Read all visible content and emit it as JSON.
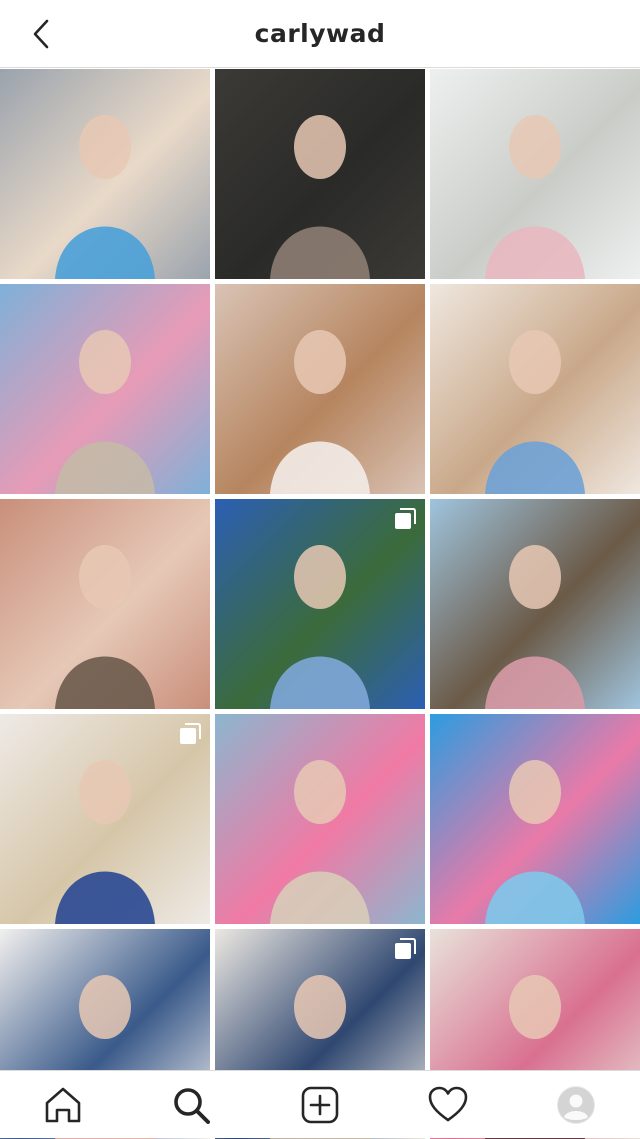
{
  "header": {
    "username": "carlywad",
    "back_icon": "chevron-left-icon"
  },
  "grid": {
    "posts": [
      {
        "id": "post-1",
        "multi": false,
        "colors": [
          "#9aa3ad",
          "#4aa0d8",
          "#e9d9c8"
        ]
      },
      {
        "id": "post-2",
        "multi": false,
        "colors": [
          "#3b3a36",
          "#8d7d72",
          "#2a2a28"
        ]
      },
      {
        "id": "post-3",
        "multi": false,
        "colors": [
          "#eef0f0",
          "#e8b8c0",
          "#c9ccc7"
        ]
      },
      {
        "id": "post-4",
        "multi": false,
        "colors": [
          "#7fb0d8",
          "#c5b9a7",
          "#e79bb6"
        ]
      },
      {
        "id": "post-5",
        "multi": false,
        "colors": [
          "#d9c3b5",
          "#f3ece8",
          "#b6855f"
        ]
      },
      {
        "id": "post-6",
        "multi": false,
        "colors": [
          "#efe7df",
          "#6fa2d6",
          "#c9a889"
        ]
      },
      {
        "id": "post-7",
        "multi": false,
        "colors": [
          "#c98f7b",
          "#6b5b4d",
          "#e6c8b7"
        ]
      },
      {
        "id": "post-8",
        "multi": true,
        "colors": [
          "#2c5fb4",
          "#7fa7d8",
          "#3b6b3a"
        ]
      },
      {
        "id": "post-9",
        "multi": false,
        "colors": [
          "#9fc4de",
          "#d79aa6",
          "#6b5a47"
        ]
      },
      {
        "id": "post-10",
        "multi": true,
        "colors": [
          "#eeeae6",
          "#294892",
          "#d6c6a8"
        ]
      },
      {
        "id": "post-11",
        "multi": false,
        "colors": [
          "#8cb6cf",
          "#d8ccb8",
          "#f07aa4"
        ]
      },
      {
        "id": "post-12",
        "multi": false,
        "colors": [
          "#2c9ce0",
          "#7fc6ea",
          "#e97aa8"
        ]
      },
      {
        "id": "post-13",
        "multi": false,
        "colors": [
          "#f2f0ee",
          "#e9b4a6",
          "#3a5a8a"
        ]
      },
      {
        "id": "post-14",
        "multi": true,
        "colors": [
          "#ece8e2",
          "#c7b9a6",
          "#2f4770"
        ]
      },
      {
        "id": "post-15",
        "multi": false,
        "colors": [
          "#e8e2da",
          "#5a2f3b",
          "#d97090"
        ]
      }
    ]
  },
  "nav": {
    "items": [
      {
        "name": "home",
        "icon": "home-icon"
      },
      {
        "name": "search",
        "icon": "search-icon"
      },
      {
        "name": "new-post",
        "icon": "add-post-icon"
      },
      {
        "name": "activity",
        "icon": "heart-icon"
      },
      {
        "name": "profile",
        "icon": "profile-avatar-icon"
      }
    ]
  }
}
